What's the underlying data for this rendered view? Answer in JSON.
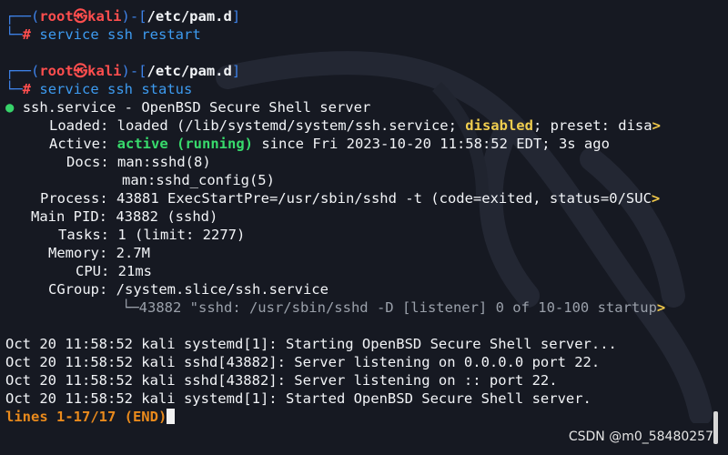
{
  "prompt_top": "┌──(",
  "prompt_open": "┌──(",
  "prompt_root": "root",
  "prompt_skull": "㉿",
  "prompt_host": "kali",
  "prompt_close": ")-[",
  "prompt_path": "/etc/pam.d",
  "prompt_end": "]",
  "prompt_bottom": "└─",
  "prompt_hash": "#",
  "cmd1": "service ssh restart",
  "cmd2": "service ssh status",
  "status": {
    "dot": "●",
    "service_line": "ssh.service - OpenBSD Secure Shell server",
    "loaded_label": "Loaded:",
    "loaded_pre": "loaded (/lib/systemd/system/ssh.service; ",
    "loaded_disabled": "disabled",
    "loaded_post": "; preset: disa",
    "truncate_marker": ">",
    "active_label": "Active:",
    "active_state": "active (running)",
    "active_since": "since Fri 2023-10-20 11:58:52 EDT; 3s ago",
    "docs_label": "Docs:",
    "docs_1": "man:sshd(8)",
    "docs_2": "man:sshd_config(5)",
    "process_label": "Process:",
    "process_value": "43881 ExecStartPre=/usr/sbin/sshd -t (code=exited, status=0/SUC",
    "mainpid_label": "Main PID:",
    "mainpid_value": "43882 (sshd)",
    "tasks_label": "Tasks:",
    "tasks_value": "1 (limit: 2277)",
    "memory_label": "Memory:",
    "memory_value": "2.7M",
    "cpu_label": "CPU:",
    "cpu_value": "21ms",
    "cgroup_label": "CGroup:",
    "cgroup_value": "/system.slice/ssh.service",
    "cgroup_proc": "└─43882 \"sshd: /usr/sbin/sshd -D [listener] 0 of 10-100 startup"
  },
  "logs": [
    "Oct 20 11:58:52 kali systemd[1]: Starting OpenBSD Secure Shell server...",
    "Oct 20 11:58:52 kali sshd[43882]: Server listening on 0.0.0.0 port 22.",
    "Oct 20 11:58:52 kali sshd[43882]: Server listening on :: port 22.",
    "Oct 20 11:58:52 kali systemd[1]: Started OpenBSD Secure Shell server."
  ],
  "pager_status": "lines 1-17/17 (END)",
  "watermark": "CSDN @m0_58480257",
  "colors": {
    "background": "#161922",
    "prompt_blue": "#3e82e8",
    "root_red": "#ff4e4e",
    "active_green": "#38db6c",
    "disabled_yellow": "#f0ce4f",
    "pager_orange": "#e98a1c"
  }
}
